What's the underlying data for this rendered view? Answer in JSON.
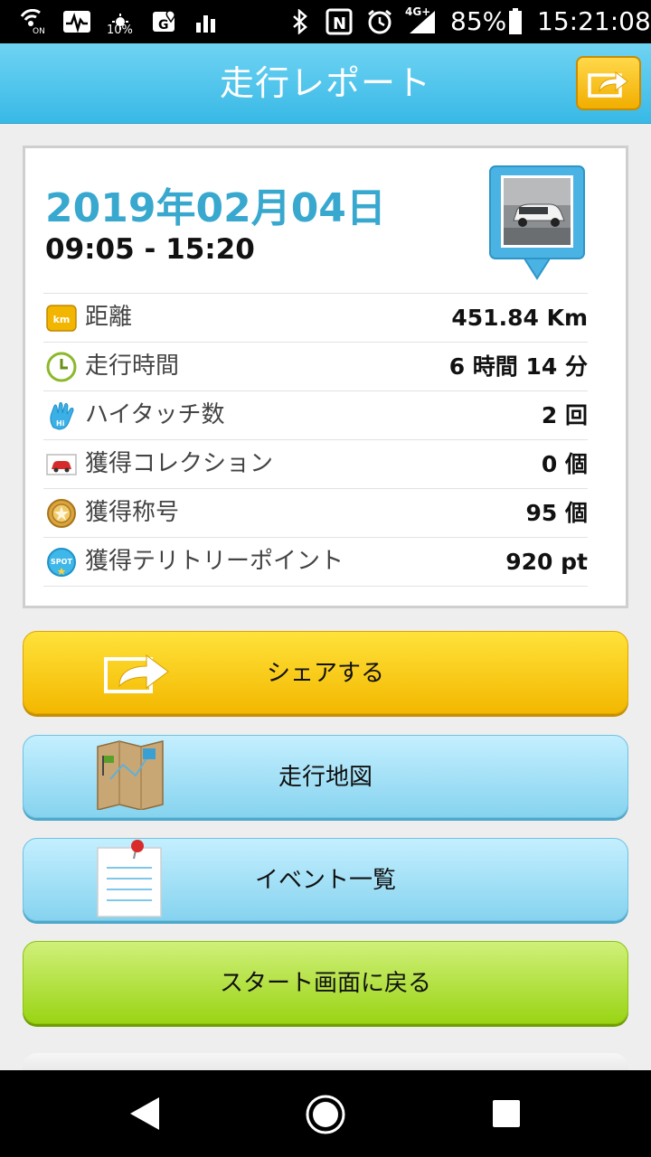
{
  "status_bar": {
    "brightness_level": "10%",
    "network": "4G+",
    "battery": "85%",
    "time": "15:21:08",
    "icons": [
      "wifi-calling-icon",
      "activity-monitor-icon",
      "brightness-icon",
      "map-icon",
      "signal-bars-icon",
      "bluetooth-icon",
      "nfc-icon",
      "alarm-icon",
      "cellular-signal-icon",
      "battery-icon"
    ]
  },
  "header": {
    "title": "走行レポート",
    "share_icon": "share-arrow-icon"
  },
  "report": {
    "date": "2019年02月04日",
    "time_range": "09:05 - 15:20",
    "photo_icon": "car-photo-pin-icon",
    "stats": [
      {
        "icon": "km-icon",
        "icon_text": "km",
        "label": "距離",
        "value": "451.84 Km"
      },
      {
        "icon": "clock-icon",
        "label": "走行時間",
        "value": "6 時間 14 分"
      },
      {
        "icon": "high-five-icon",
        "label": "ハイタッチ数",
        "value": "2 回"
      },
      {
        "icon": "car-collection-icon",
        "label": "獲得コレクション",
        "value": "0 個"
      },
      {
        "icon": "medal-icon",
        "label": "獲得称号",
        "value": "95 個"
      },
      {
        "icon": "spot-icon",
        "icon_text": "SPOT",
        "label": "獲得テリトリーポイント",
        "value": "920 pt"
      }
    ]
  },
  "buttons": {
    "share": "シェアする",
    "map": "走行地図",
    "events": "イベント一覧",
    "start": "スタート画面に戻る"
  },
  "colors": {
    "header": "#38b9e6",
    "date": "#38a8cf",
    "share_button": "#f3b800",
    "map_button": "#86d3ef",
    "start_button": "#9ad414"
  }
}
